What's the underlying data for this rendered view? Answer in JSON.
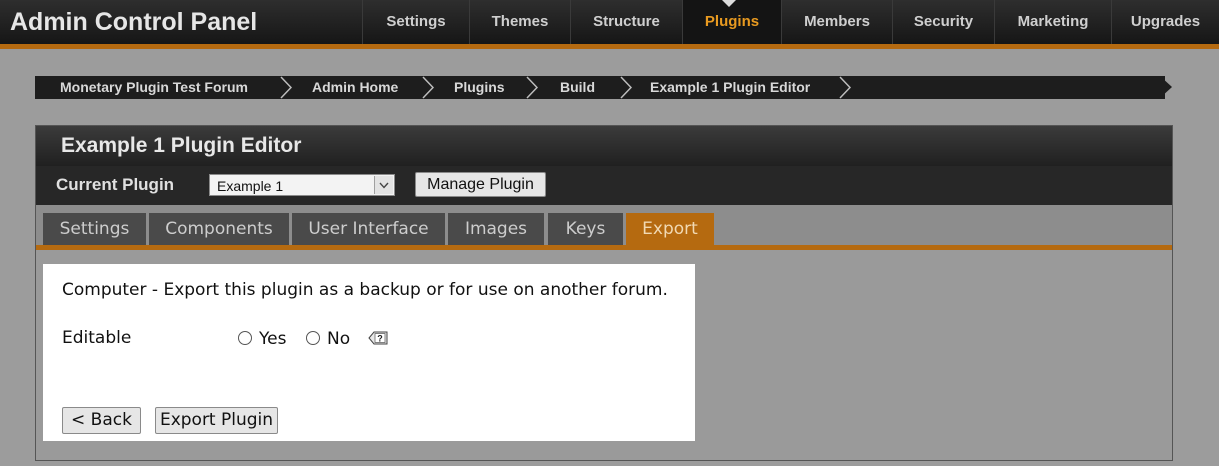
{
  "app": {
    "title": "Admin Control Panel"
  },
  "nav": {
    "items": [
      {
        "label": "Settings"
      },
      {
        "label": "Themes"
      },
      {
        "label": "Structure"
      },
      {
        "label": "Plugins"
      },
      {
        "label": "Members"
      },
      {
        "label": "Security"
      },
      {
        "label": "Marketing"
      },
      {
        "label": "Upgrades"
      }
    ],
    "active": "Plugins"
  },
  "breadcrumb": [
    {
      "label": "Monetary Plugin Test Forum"
    },
    {
      "label": "Admin Home"
    },
    {
      "label": "Plugins"
    },
    {
      "label": "Build"
    },
    {
      "label": "Example 1 Plugin Editor"
    }
  ],
  "panel": {
    "title": "Example 1 Plugin Editor",
    "current_plugin_label": "Current Plugin",
    "plugin_select_value": "Example 1",
    "manage_button": "Manage Plugin"
  },
  "tabs": [
    {
      "label": "Settings"
    },
    {
      "label": "Components"
    },
    {
      "label": "User Interface"
    },
    {
      "label": "Images"
    },
    {
      "label": "Keys"
    },
    {
      "label": "Export"
    }
  ],
  "active_tab": "Export",
  "export": {
    "description": "Computer - Export this plugin as a backup or for use on another forum.",
    "editable_label": "Editable",
    "option_yes": "Yes",
    "option_no": "No",
    "back_button": "< Back",
    "export_button": "Export Plugin"
  },
  "colors": {
    "accent": "#b56a10",
    "active_nav_text": "#e89a20"
  },
  "icons": [
    "chevron-down-icon",
    "help-icon",
    "breadcrumb-separator-icon",
    "active-nav-caret-icon"
  ]
}
